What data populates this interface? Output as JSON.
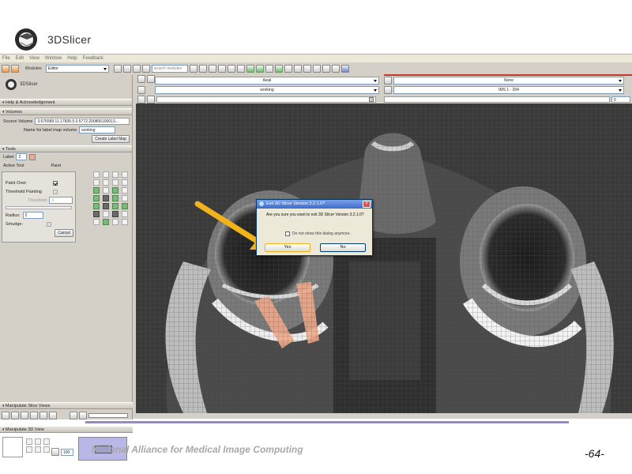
{
  "brand": {
    "name": "3DSlicer"
  },
  "menu": [
    "File",
    "Edit",
    "View",
    "Window",
    "Help",
    "Feedback"
  ],
  "toolbar": {
    "modules_label": "Modules",
    "module_value": "Editor",
    "search_placeholder": "search modules"
  },
  "module_panel": {
    "logo": "3DSlicer",
    "sections": {
      "help": "Help & Acknowledgement",
      "volumes": "Volumes",
      "tools": "Tools",
      "slice_views": "Manipulate Slice Views",
      "view3d": "Manipulate 3D View"
    },
    "volumes": {
      "source_label": "Source Volume",
      "source_value": "3.676589.11.17835.5.0.5772.200806100013...",
      "labelmap_label": "Name for label map volume",
      "labelmap_value": "working",
      "create_button": "Create Label Map"
    },
    "tools": {
      "label_label": "Label",
      "label_value": "2",
      "active_tool_label": "Active Tool",
      "active_tool_value": "Paint",
      "paint_over": "Paint Over:",
      "threshold_painting": "Threshold Painting",
      "threshold": "Threshold",
      "threshold_value": "1",
      "radius": "Radius:",
      "radius_value": "2",
      "smudge": "Smudge:",
      "cancel": "Cancel"
    },
    "view3d_zoom": "100"
  },
  "viewer": {
    "fg_value": "Axial",
    "bg_value": "working",
    "right_fg_value": "None",
    "right_bg_value": "IMS 1 - 204",
    "slider_value": "0"
  },
  "dialog": {
    "title": "Exit 3D Slicer Version 3.2.1.0?",
    "message": "Are you sure you want to exit 3D Slicer Version 3.2.1.0?",
    "checkbox": "Do not show this dialog anymore.",
    "yes": "Yes",
    "no": "No"
  },
  "footer": {
    "org": "National Alliance for Medical Image Computing",
    "page": "-64-"
  },
  "colors": {
    "arrow": "#f2b21c",
    "paint_label": "#f0a98a",
    "accent_line": "#9a86c8"
  }
}
